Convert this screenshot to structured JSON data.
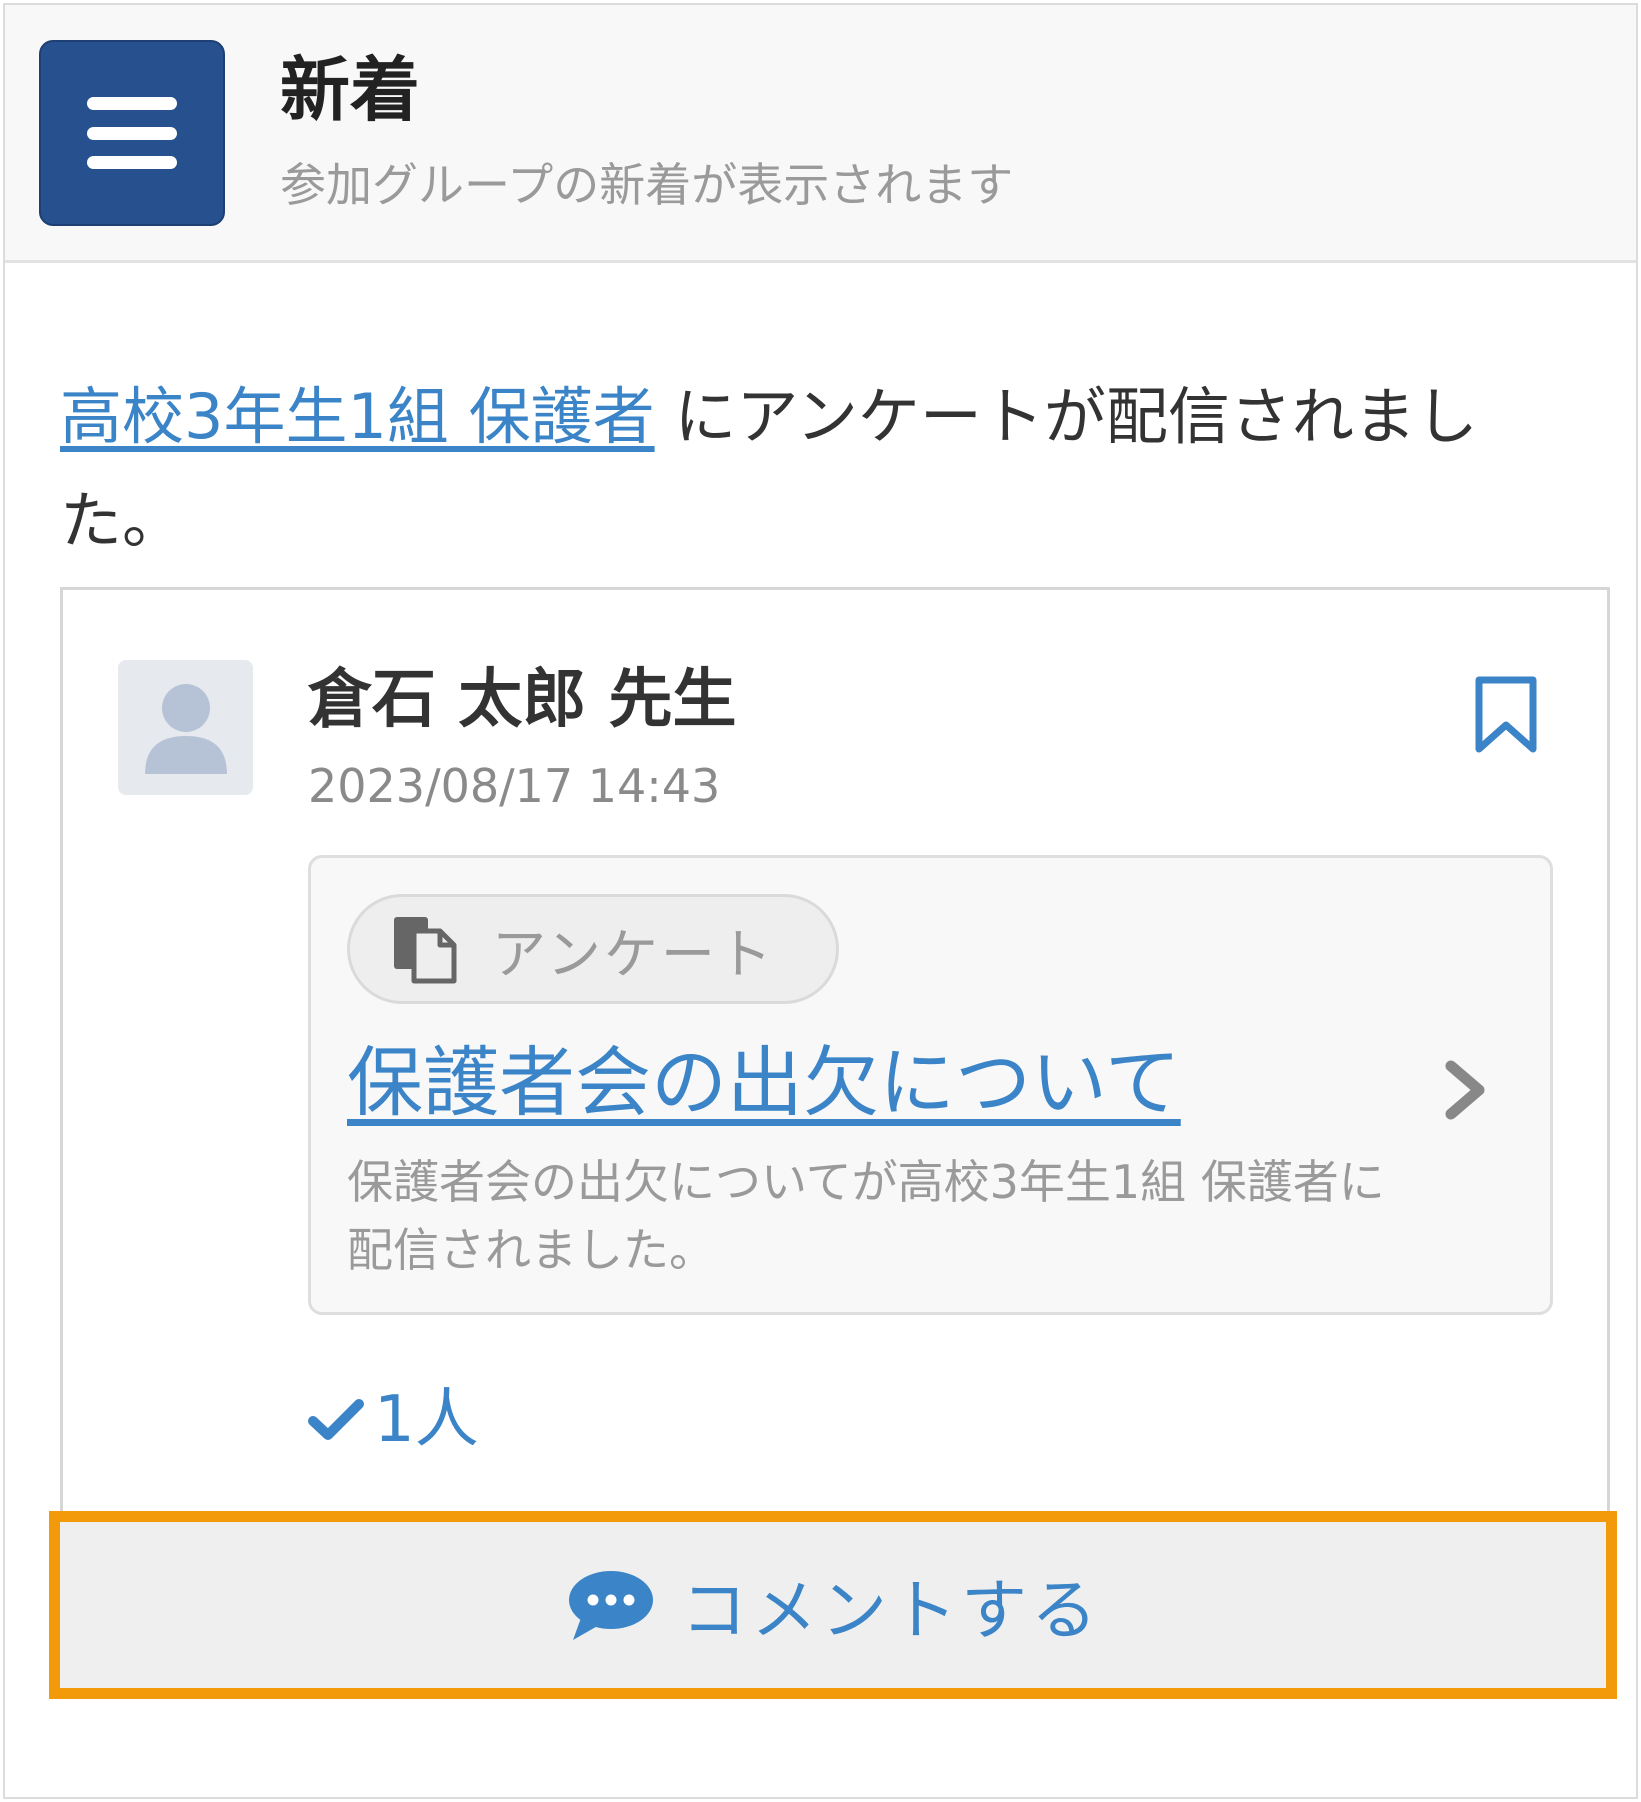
{
  "header": {
    "title": "新着",
    "subtitle": "参加グループの新着が表示されます",
    "menu_icon": "hamburger-menu-icon"
  },
  "notice": {
    "group_link": "高校3年生1組 保護者",
    "message": " にアンケートが配信されました。"
  },
  "post": {
    "author": "倉石 太郎 先生",
    "timestamp": "2023/08/17 14:43",
    "avatar_icon": "user-silhouette-icon",
    "bookmark_icon": "bookmark-icon",
    "attachment": {
      "tag_icon": "document-copy-icon",
      "tag_label": "アンケート",
      "title": "保護者会の出欠について",
      "description": "保護者会の出欠についてが高校3年生1組 保護者に配信されました。",
      "chevron_icon": "chevron-right-icon"
    },
    "reaction": {
      "icon": "checkmark-icon",
      "count_label": "1人"
    }
  },
  "comment_button": {
    "icon": "speech-bubble-icon",
    "label": "コメントする"
  },
  "colors": {
    "accent": "#3a84c7",
    "menu_bg": "#27508f",
    "highlight_border": "#f29a09"
  }
}
